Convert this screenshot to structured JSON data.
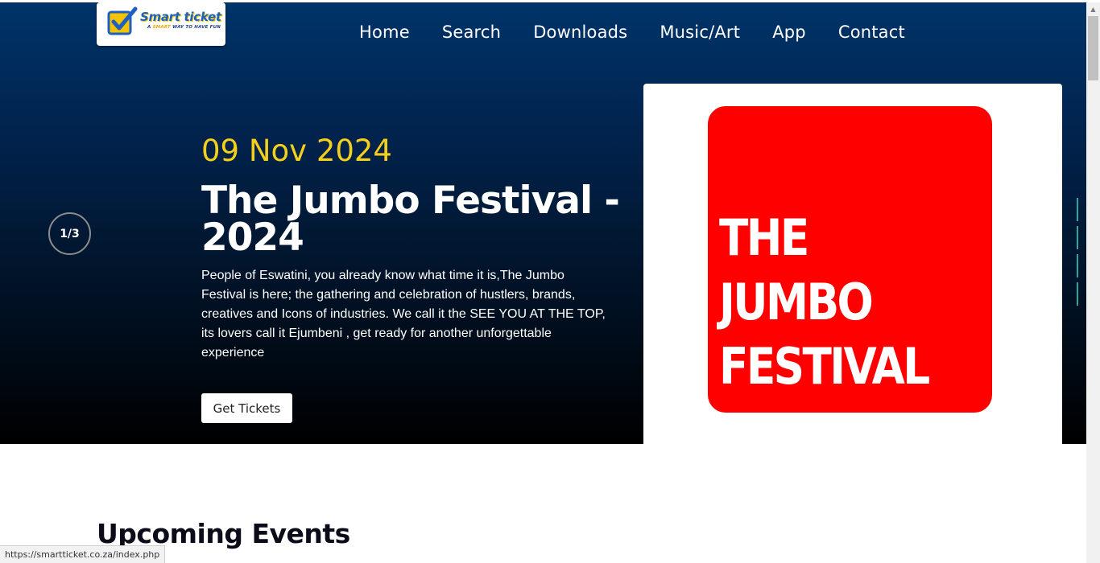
{
  "brand": {
    "name": "Smart ticket",
    "tagline_pre": "A ",
    "tagline_hl": "SMART",
    "tagline_post": " WAY TO HAVE FUN"
  },
  "nav": {
    "items": [
      "Home",
      "Search",
      "Downloads",
      "Music/Art",
      "App",
      "Contact"
    ]
  },
  "slider": {
    "counter": "1/3",
    "date": "09 Nov 2024",
    "title": "The Jumbo Festival - 2024",
    "description": "People of Eswatini, you already know what time it is,The Jumbo Festival is here; the gathering and celebration of hustlers, brands, creatives and Icons of industries. We call it the SEE YOU AT THE TOP, its lovers call it Ejumbeni , get ready for another unforgettable experience",
    "button_label": "Get Tickets",
    "poster_lines": [
      "THE",
      "JUMBO",
      "FESTIVAL"
    ]
  },
  "section": {
    "title": "Upcoming Events"
  },
  "status_bar": {
    "url": "https://smartticket.co.za/index.php"
  },
  "colors": {
    "accent_date": "#f4cf1c",
    "poster_red": "#ff0000",
    "indicator": "#2aa7a0",
    "hero_top": "#003469",
    "hero_bottom": "#000000"
  }
}
